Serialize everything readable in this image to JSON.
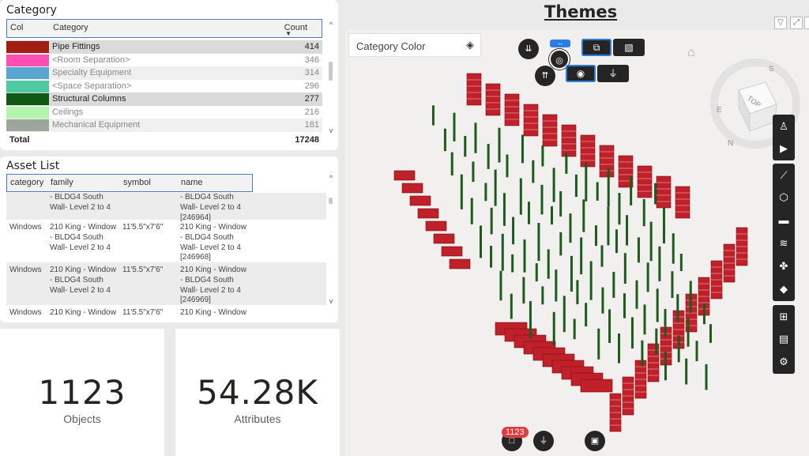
{
  "category_panel": {
    "title": "Category",
    "columns": [
      "Col",
      "Category",
      "Count"
    ],
    "rows": [
      {
        "label": "Pipe Fittings",
        "count": "414",
        "color": "#a01f12",
        "dark": true,
        "shade": "hl"
      },
      {
        "label": "<Room Separation>",
        "count": "346",
        "color": "#ff4fb3",
        "dark": false,
        "shade": ""
      },
      {
        "label": "Specialty Equipment",
        "count": "314",
        "color": "#5aa6d2",
        "dark": false,
        "shade": "alt"
      },
      {
        "label": "<Space Separation>",
        "count": "296",
        "color": "#4fc9a2",
        "dark": false,
        "shade": ""
      },
      {
        "label": "Structural Columns",
        "count": "277",
        "color": "#0f5a13",
        "dark": true,
        "shade": "hl"
      },
      {
        "label": "Ceilings",
        "count": "216",
        "color": "#b3f5ad",
        "dark": false,
        "shade": ""
      },
      {
        "label": "Mechanical Equipment",
        "count": "181",
        "color": "#9ea59a",
        "dark": false,
        "shade": "alt"
      }
    ],
    "total_label": "Total",
    "total_value": "17248"
  },
  "asset_panel": {
    "title": "Asset List",
    "columns": [
      "category",
      "family",
      "symbol",
      "name"
    ],
    "rows": [
      {
        "category": "",
        "family": "- BLDG4 South\nWall- Level 2 to 4",
        "symbol": "",
        "name": "- BLDG4 South\nWall- Level 2 to 4\n[246964]"
      },
      {
        "category": "Windows",
        "family": "210 King - Window\n- BLDG4 South\nWall- Level 2 to 4",
        "symbol": "11'5.5\"x7'6\"",
        "name": "210 King - Window\n- BLDG4 South\nWall- Level 2 to 4\n[246968]"
      },
      {
        "category": "Windows",
        "family": "210 King - Window\n- BLDG4 South\nWall- Level 2 to 4",
        "symbol": "11'5.5\"x7'6\"",
        "name": "210 King - Window\n- BLDG4 South\nWall- Level 2 to 4\n[246969]"
      },
      {
        "category": "Windows",
        "family": "210 King - Window",
        "symbol": "11'5.5\"x7'6\"",
        "name": "210 King - Window"
      }
    ]
  },
  "kpis": {
    "objects_value": "1123",
    "objects_label": "Objects",
    "attributes_value": "54.28K",
    "attributes_label": "Attributes"
  },
  "viewer": {
    "title": "Themes",
    "color_by": "Category Color",
    "selection_badge": "1123",
    "compass_letters": [
      "S",
      "E",
      "N"
    ],
    "cube_label": "TOP",
    "colors": {
      "accent": "#2a7de1",
      "wall": "#c0202a",
      "column": "#1e5a1e",
      "toolbar": "#252525"
    }
  }
}
